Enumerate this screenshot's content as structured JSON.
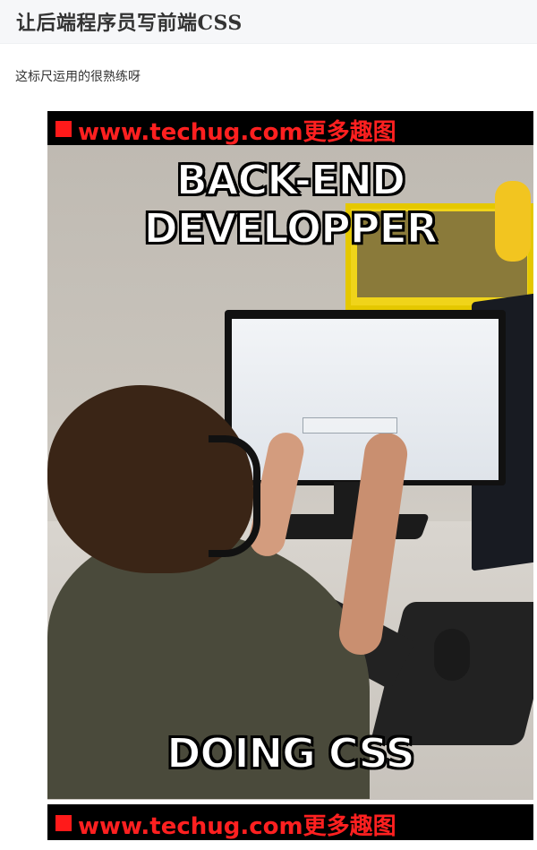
{
  "article": {
    "title": "让后端程序员写前端CSS",
    "description": "这标尺运用的很熟练呀"
  },
  "meme": {
    "watermark_top": "www.techug.com更多趣图",
    "caption_top": "BACK-END DEVELOPPER",
    "caption_bottom": "DOING CSS",
    "watermark_bottom": "www.techug.com更多趣图"
  },
  "colors": {
    "header_bg": "#f6f7f9",
    "watermark_red": "#ff2020",
    "watermark_bg": "#000000"
  }
}
